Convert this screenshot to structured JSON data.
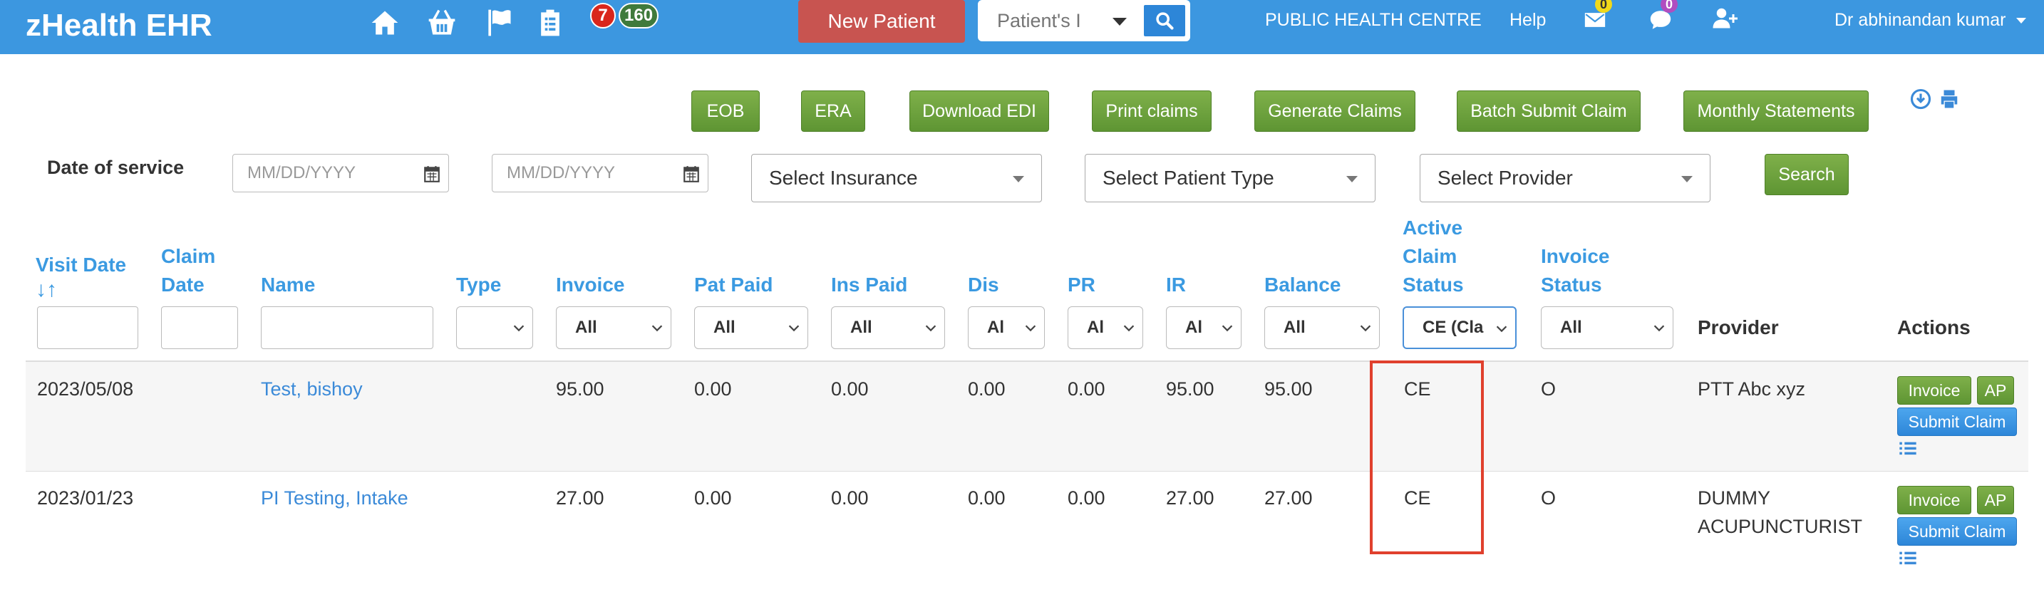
{
  "app": {
    "brand": "zHealth EHR",
    "accent_color": "#3c97e0"
  },
  "topnav": {
    "icons": [
      "home-icon",
      "basket-icon",
      "flag-icon",
      "clipboard-icon"
    ],
    "badge_red": "7",
    "badge_green": "160",
    "new_patient_label": "New Patient",
    "search_placeholder": "Patient's I",
    "centre_label": "PUBLIC HEALTH CENTRE",
    "help_label": "Help",
    "mail_count": "0",
    "chat_count": "0",
    "user_label": "Dr abhinandan kumar"
  },
  "toolbar": {
    "buttons": [
      "EOB",
      "ERA",
      "Download EDI",
      "Print claims",
      "Generate Claims",
      "Batch Submit Claim",
      "Monthly Statements"
    ]
  },
  "filters": {
    "date_label": "Date of service",
    "date_from_placeholder": "MM/DD/YYYY",
    "date_to_placeholder": "MM/DD/YYYY",
    "insurance": "Select Insurance",
    "patient_type": "Select Patient Type",
    "provider": "Select Provider",
    "search_label": "Search"
  },
  "table": {
    "headers": {
      "visit_date": "Visit Date",
      "claim_date_1": "Claim",
      "claim_date_2": "Date",
      "name": "Name",
      "type": "Type",
      "invoice": "Invoice",
      "pat_paid": "Pat Paid",
      "ins_paid": "Ins Paid",
      "dis": "Dis",
      "pr": "PR",
      "ir": "IR",
      "balance": "Balance",
      "active_1": "Active",
      "active_2": "Claim",
      "active_3": "Status",
      "invoice_status_1": "Invoice",
      "invoice_status_2": "Status",
      "provider": "Provider",
      "actions": "Actions"
    },
    "column_filters": {
      "invoice": "All",
      "pat_paid": "All",
      "ins_paid": "All",
      "dis": "Al",
      "pr": "Al",
      "ir": "Al",
      "balance": "All",
      "active_claim_status": "CE (Cla",
      "invoice_status": "All"
    },
    "rows": [
      {
        "visit_date": "2023/05/08",
        "name": "Test, bishoy",
        "invoice": "95.00",
        "pat_paid": "0.00",
        "ins_paid": "0.00",
        "dis": "0.00",
        "pr": "0.00",
        "ir": "95.00",
        "balance": "95.00",
        "active_claim_status": "CE",
        "invoice_status": "O",
        "provider_line1": "PTT Abc xyz",
        "provider_line2": ""
      },
      {
        "visit_date": "2023/01/23",
        "name": "PI Testing, Intake",
        "invoice": "27.00",
        "pat_paid": "0.00",
        "ins_paid": "0.00",
        "dis": "0.00",
        "pr": "0.00",
        "ir": "27.00",
        "balance": "27.00",
        "active_claim_status": "CE",
        "invoice_status": "O",
        "provider_line1": "DUMMY",
        "provider_line2": "ACUPUNCTURIST"
      }
    ],
    "actions": {
      "invoice_label": "Invoice",
      "ap_label": "AP",
      "submit_claim_label": "Submit Claim"
    }
  }
}
